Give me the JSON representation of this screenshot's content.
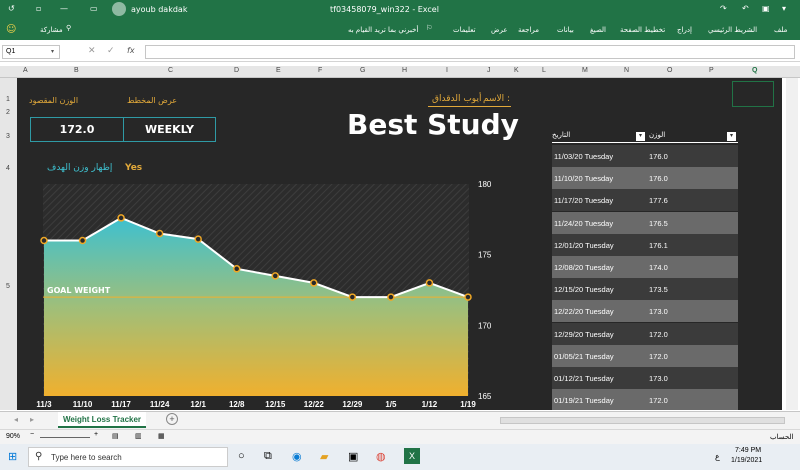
{
  "window": {
    "title": "tf03458079_win322  -  Excel",
    "user": "ayoub dakdak",
    "share_label": "مشاركة",
    "tell_me": "أخبرني بما تريد القيام به"
  },
  "ribbon": {
    "tabs": [
      "ملف",
      "الشريط الرئيسي",
      "إدراج",
      "تخطيط الصفحة",
      "الصيغ",
      "بيانات",
      "مراجعة",
      "عرض",
      "تعليمات"
    ]
  },
  "formula_bar": {
    "name_box": "Q1",
    "fx": "fx"
  },
  "columns": [
    "A",
    "B",
    "C",
    "D",
    "E",
    "F",
    "G",
    "H",
    "I",
    "J",
    "K",
    "L",
    "M",
    "N",
    "O",
    "P",
    "Q"
  ],
  "rows": [
    "1",
    "2",
    "3",
    "4",
    "5"
  ],
  "sheet": {
    "target_weight_label": "الوزن المقصود",
    "view_plan_label": "عرض المخطط",
    "name_label": "الاسم :",
    "name_value": "أيوب الدقداق",
    "target_weight_value": "172.0",
    "plan_value": "WEEKLY",
    "title": "Best Study",
    "show_goal_label": "إظهار وزن الهدف",
    "show_goal_value": "Yes",
    "goal_weight_label": "GOAL WEIGHT"
  },
  "chart_data": {
    "type": "area",
    "x": [
      "11/3",
      "11/10",
      "11/17",
      "11/24",
      "12/1",
      "12/8",
      "12/15",
      "12/22",
      "12/29",
      "1/5",
      "1/12",
      "1/19"
    ],
    "values": [
      176.0,
      176.0,
      177.6,
      176.5,
      176.1,
      174.0,
      173.5,
      173.0,
      172.0,
      172.0,
      173.0,
      172.0
    ],
    "goal": 172.0,
    "yticks": [
      "180",
      "175",
      "170",
      "165"
    ],
    "ylim": [
      165,
      180
    ],
    "grid": false,
    "colors": {
      "area_top": "#3ec0cf",
      "area_bottom": "#f0b02e",
      "line": "#ffffff",
      "marker": "#f0a826",
      "goal_line": "#f0b02e"
    }
  },
  "table": {
    "headers": [
      "التاريخ",
      "الوزن"
    ],
    "rows": [
      [
        "11/03/20 Tuesday",
        "176.0"
      ],
      [
        "11/10/20 Tuesday",
        "176.0"
      ],
      [
        "11/17/20 Tuesday",
        "177.6"
      ],
      [
        "11/24/20 Tuesday",
        "176.5"
      ],
      [
        "12/01/20 Tuesday",
        "176.1"
      ],
      [
        "12/08/20 Tuesday",
        "174.0"
      ],
      [
        "12/15/20 Tuesday",
        "173.5"
      ],
      [
        "12/22/20 Tuesday",
        "173.0"
      ],
      [
        "12/29/20 Tuesday",
        "172.0"
      ],
      [
        "01/05/21 Tuesday",
        "172.0"
      ],
      [
        "01/12/21 Tuesday",
        "173.0"
      ],
      [
        "01/19/21 Tuesday",
        "172.0"
      ]
    ]
  },
  "tabs": {
    "active": "Weight Loss Tracker",
    "add": "+"
  },
  "status": {
    "zoom": "90%",
    "mode": "الحساب"
  },
  "taskbar": {
    "search_placeholder": "Type here to search",
    "time": "7:49 PM",
    "date": "1/19/2021",
    "lang": "ع"
  }
}
